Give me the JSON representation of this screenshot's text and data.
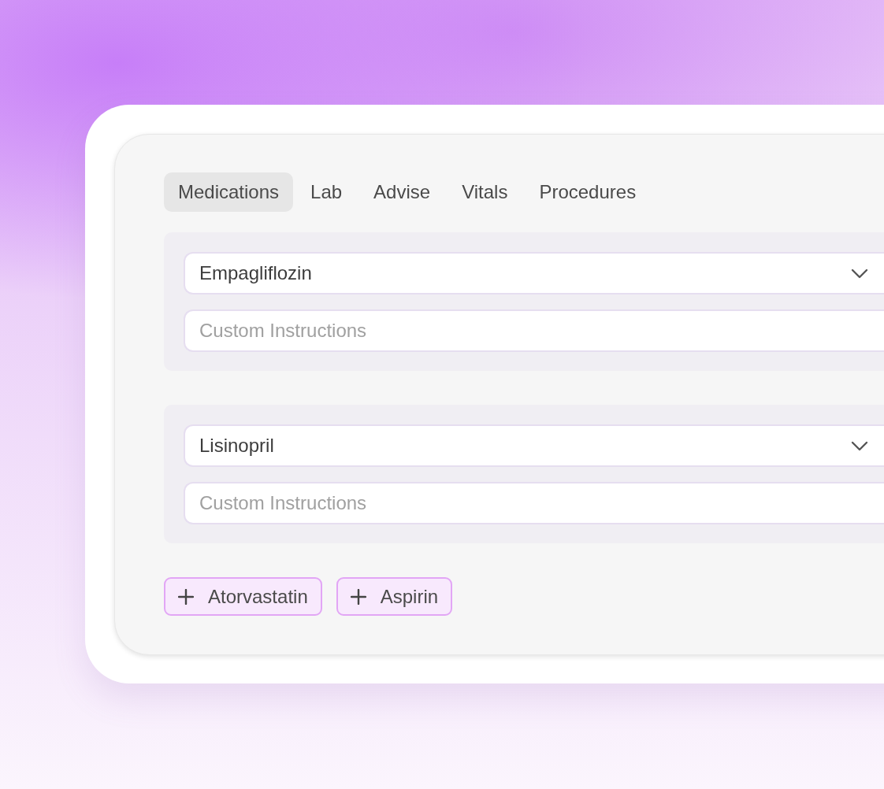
{
  "tabs": [
    {
      "label": "Medications",
      "selected": true
    },
    {
      "label": "Lab",
      "selected": false
    },
    {
      "label": "Advise",
      "selected": false
    },
    {
      "label": "Vitals",
      "selected": false
    },
    {
      "label": "Procedures",
      "selected": false
    }
  ],
  "medications": [
    {
      "drug": "Empagliflozin",
      "instructions": {
        "placeholder": "Custom Instructions"
      }
    },
    {
      "drug": "Lisinopril",
      "instructions": {
        "placeholder": "Custom Instructions"
      }
    }
  ],
  "suggestions": [
    "Atorvastatin",
    "Aspirin"
  ]
}
